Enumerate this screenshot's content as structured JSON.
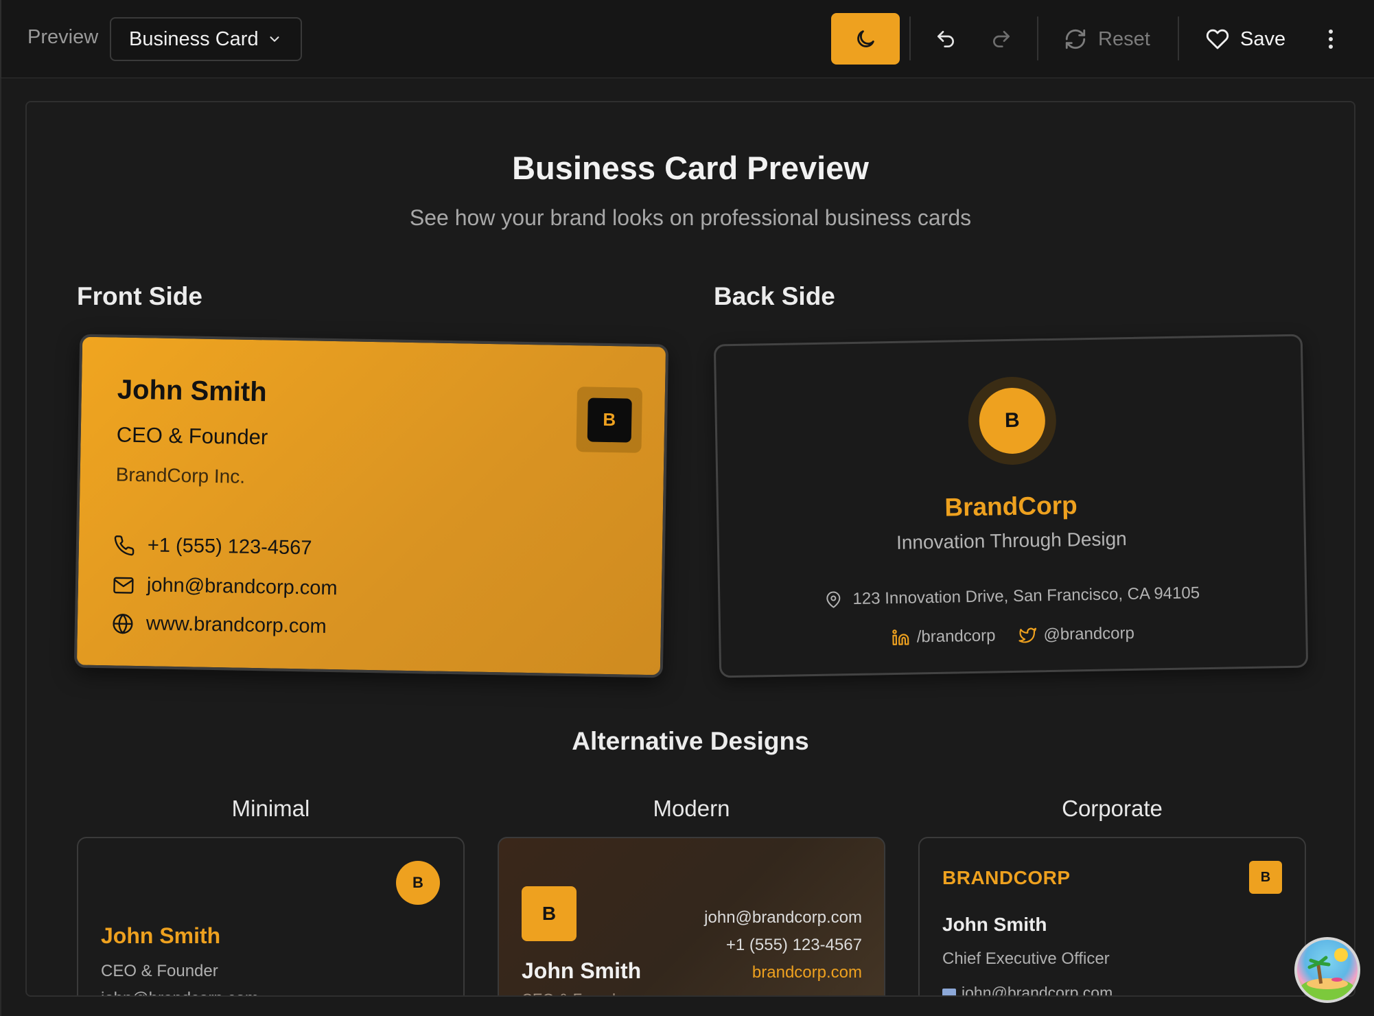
{
  "toolbar": {
    "preview_label": "Preview",
    "template_select": "Business Card",
    "reset_label": "Reset",
    "save_label": "Save",
    "accent": "#eea11f",
    "icons": [
      "chevron-down-icon",
      "moon-icon",
      "undo-icon",
      "redo-icon",
      "refresh-icon",
      "heart-icon",
      "more-vertical-icon"
    ]
  },
  "page": {
    "title": "Business Card Preview",
    "subtitle": "See how your brand looks on professional business cards"
  },
  "front": {
    "heading": "Front Side",
    "name": "John Smith",
    "role": "CEO & Founder",
    "company": "BrandCorp Inc.",
    "logo_letter": "B",
    "phone": "+1 (555) 123-4567",
    "email": "john@brandcorp.com",
    "website": "www.brandcorp.com"
  },
  "back": {
    "heading": "Back Side",
    "logo_letter": "B",
    "brand": "BrandCorp",
    "tagline": "Innovation Through Design",
    "address": "123 Innovation Drive, San Francisco, CA 94105",
    "linkedin": "/brandcorp",
    "twitter": "@brandcorp"
  },
  "alternatives": {
    "heading": "Alternative Designs",
    "minimal": {
      "label": "Minimal",
      "logo_letter": "B",
      "name": "John Smith",
      "role": "CEO & Founder",
      "email": "john@brandcorp.com"
    },
    "modern": {
      "label": "Modern",
      "logo_letter": "B",
      "name": "John Smith",
      "role": "CEO & Founder",
      "email": "john@brandcorp.com",
      "phone": "+1 (555) 123-4567",
      "website": "brandcorp.com"
    },
    "corporate": {
      "label": "Corporate",
      "brand": "BRANDCORP",
      "logo_letter": "B",
      "name": "John Smith",
      "role": "Chief Executive Officer",
      "email": "john@brandcorp.com"
    }
  }
}
